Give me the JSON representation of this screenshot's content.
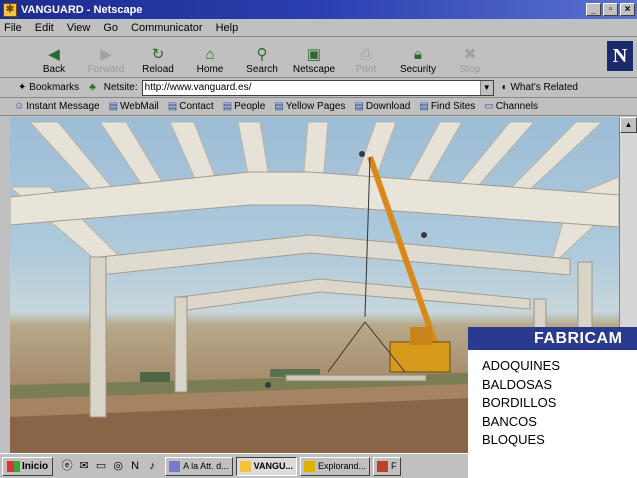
{
  "window": {
    "title": "VANGUARD - Netscape"
  },
  "menu": [
    "File",
    "Edit",
    "View",
    "Go",
    "Communicator",
    "Help"
  ],
  "toolbar": [
    {
      "label": "Back",
      "icon": "back-arrow-icon",
      "enabled": true
    },
    {
      "label": "Forward",
      "icon": "forward-arrow-icon",
      "enabled": false
    },
    {
      "label": "Reload",
      "icon": "reload-icon",
      "enabled": true
    },
    {
      "label": "Home",
      "icon": "home-icon",
      "enabled": true
    },
    {
      "label": "Search",
      "icon": "search-icon",
      "enabled": true
    },
    {
      "label": "Netscape",
      "icon": "netscape-icon",
      "enabled": true
    },
    {
      "label": "Print",
      "icon": "print-icon",
      "enabled": false
    },
    {
      "label": "Security",
      "icon": "security-lock-icon",
      "enabled": true
    },
    {
      "label": "Stop",
      "icon": "stop-icon",
      "enabled": false
    }
  ],
  "location": {
    "bookmarks_label": "Bookmarks",
    "netsite_label": "Netsite:",
    "url": "http://www.vanguard.es/",
    "whats_related": "What's Related"
  },
  "personal_toolbar": [
    "Instant Message",
    "WebMail",
    "Contact",
    "People",
    "Yellow Pages",
    "Download",
    "Find Sites",
    "Channels"
  ],
  "panel": {
    "header": "FABRICAM",
    "items": [
      "ADOQUINES",
      "BALDOSAS",
      "BORDILLOS",
      "BANCOS",
      "BLOQUES"
    ]
  },
  "taskbar": {
    "start_label": "Inicio",
    "tasks": [
      {
        "label": "A la Att. d...",
        "active": false
      },
      {
        "label": "VANGU...",
        "active": true
      },
      {
        "label": "Explorand...",
        "active": false
      },
      {
        "label": "F",
        "active": false
      }
    ]
  },
  "colors": {
    "title_bar": "#1c2b8e",
    "panel_header": "#2a3b8f",
    "desktop_border": "#f2c23a"
  }
}
